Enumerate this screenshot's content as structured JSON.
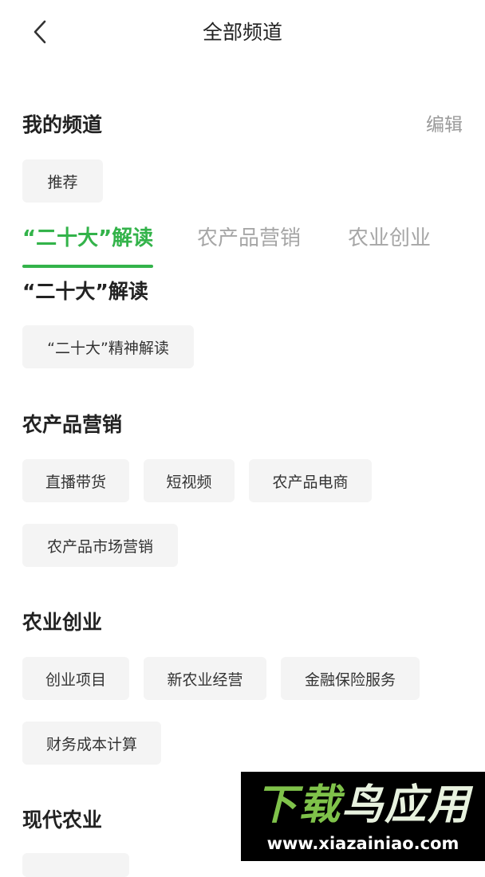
{
  "header": {
    "title": "全部频道",
    "back_icon": "chevron-left-icon"
  },
  "my_channels": {
    "title": "我的频道",
    "edit_label": "编辑",
    "items": [
      "推荐"
    ]
  },
  "tabs": [
    {
      "label": "“二十大”解读",
      "active": true
    },
    {
      "label": "农产品营销",
      "active": false
    },
    {
      "label": "农业创业",
      "active": false
    }
  ],
  "colors": {
    "accent": "#33b34a",
    "chip_bg": "#f4f4f4",
    "muted": "#a6a6a6"
  },
  "sections": [
    {
      "title": "“二十大”解读",
      "items": [
        "“二十大”精神解读"
      ]
    },
    {
      "title": "农产品营销",
      "items": [
        "直播带货",
        "短视频",
        "农产品电商",
        "农产品市场营销"
      ]
    },
    {
      "title": "农业创业",
      "items": [
        "创业项目",
        "新农业经营",
        "金融保险服务",
        "财务成本计算"
      ]
    },
    {
      "title": "现代农业",
      "items": []
    }
  ],
  "watermark": {
    "logo_part1": "下载",
    "logo_part2": "鸟应用",
    "url": "www.xiazainiao.com"
  }
}
